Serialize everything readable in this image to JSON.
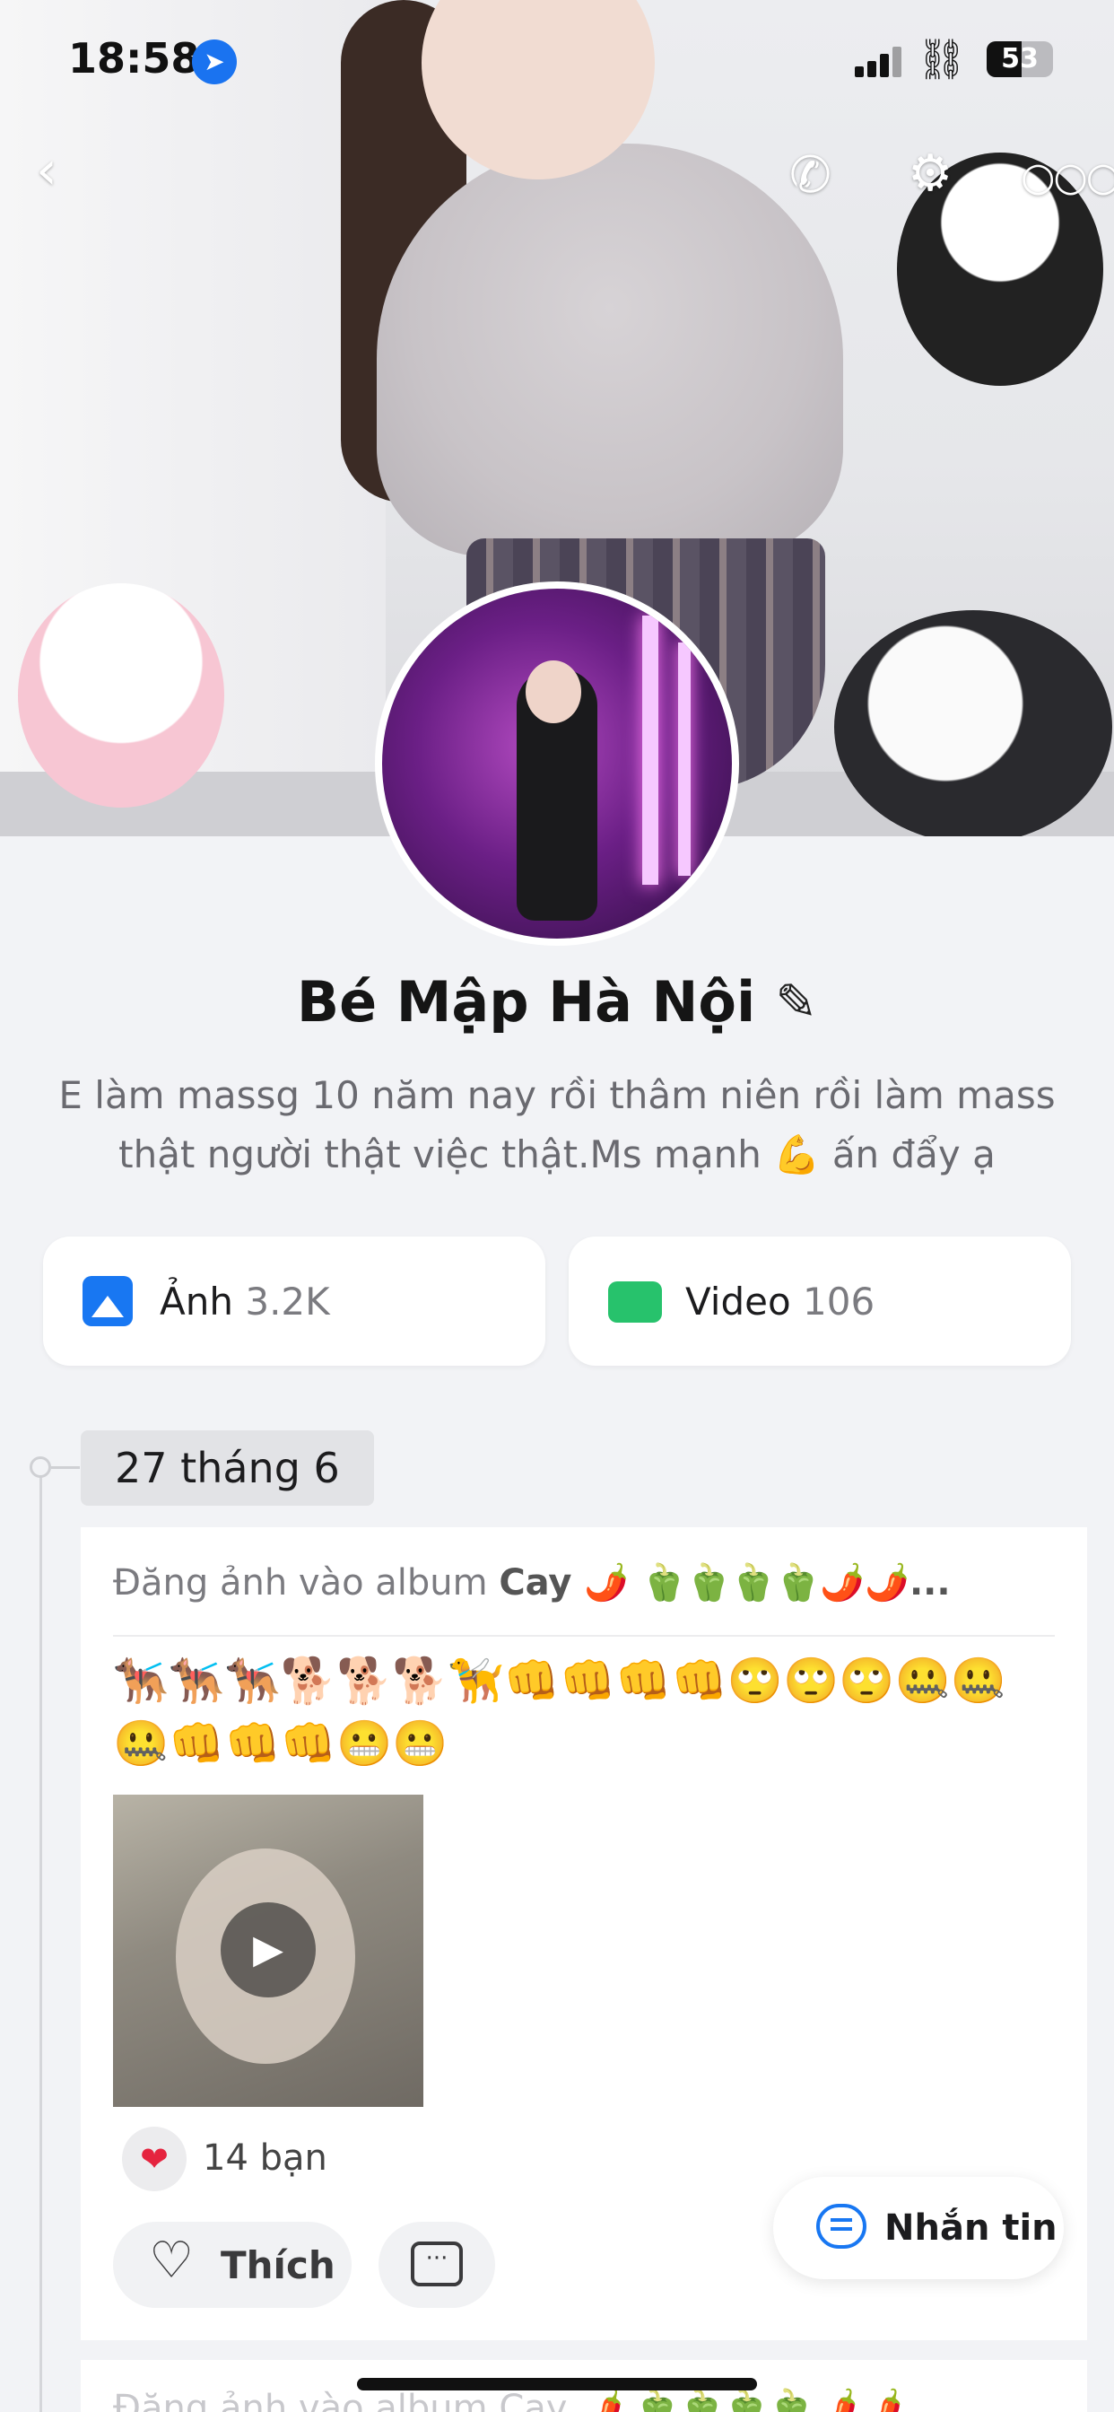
{
  "status_bar": {
    "time": "18:58",
    "battery": "53",
    "battery_level": 0.53
  },
  "profile": {
    "name": "Bé Mập Hà Nội",
    "bio": "E làm massg 10 năm nay rồi thâm niên rồi làm mass thật người thật việc thật.Ms mạnh 💪 ấn đẩy ạ"
  },
  "media": {
    "photos_label": "Ảnh",
    "photos_count": "3.2K",
    "videos_label": "Video",
    "videos_count": "106"
  },
  "timeline": {
    "date": "27 tháng 6",
    "post": {
      "header_prefix": "Đăng ảnh vào album ",
      "album_name": "Cay 🌶️ 🫑🫑🫑🫑🌶️🌶️...",
      "text": "🐕‍🦺🐕‍🦺🐕‍🦺🐕🐕🐕🦮👊👊👊👊🙄🙄🙄🤐🤐🤐👊👊👊😬😬",
      "likes": "14 bạn",
      "like_label": "Thích"
    },
    "next_post_peek": "Đăng ảnh vào album Cay 🌶️ 🫑🫑🫑🫑🌶️🌶️"
  },
  "floating": {
    "message_label": "Nhắn tin"
  },
  "icons": {
    "back": "back-icon",
    "call": "phone-icon",
    "settings": "user-settings-icon",
    "more": "more-icon",
    "edit": "pencil-icon",
    "photo": "photo-icon",
    "video": "video-icon",
    "heart": "heart-icon",
    "like": "heart-outline-icon",
    "comment": "comment-icon",
    "message": "message-icon"
  },
  "colors": {
    "accent": "#1877f2",
    "video_green": "#27c26c",
    "heart_red": "#e5243f"
  }
}
